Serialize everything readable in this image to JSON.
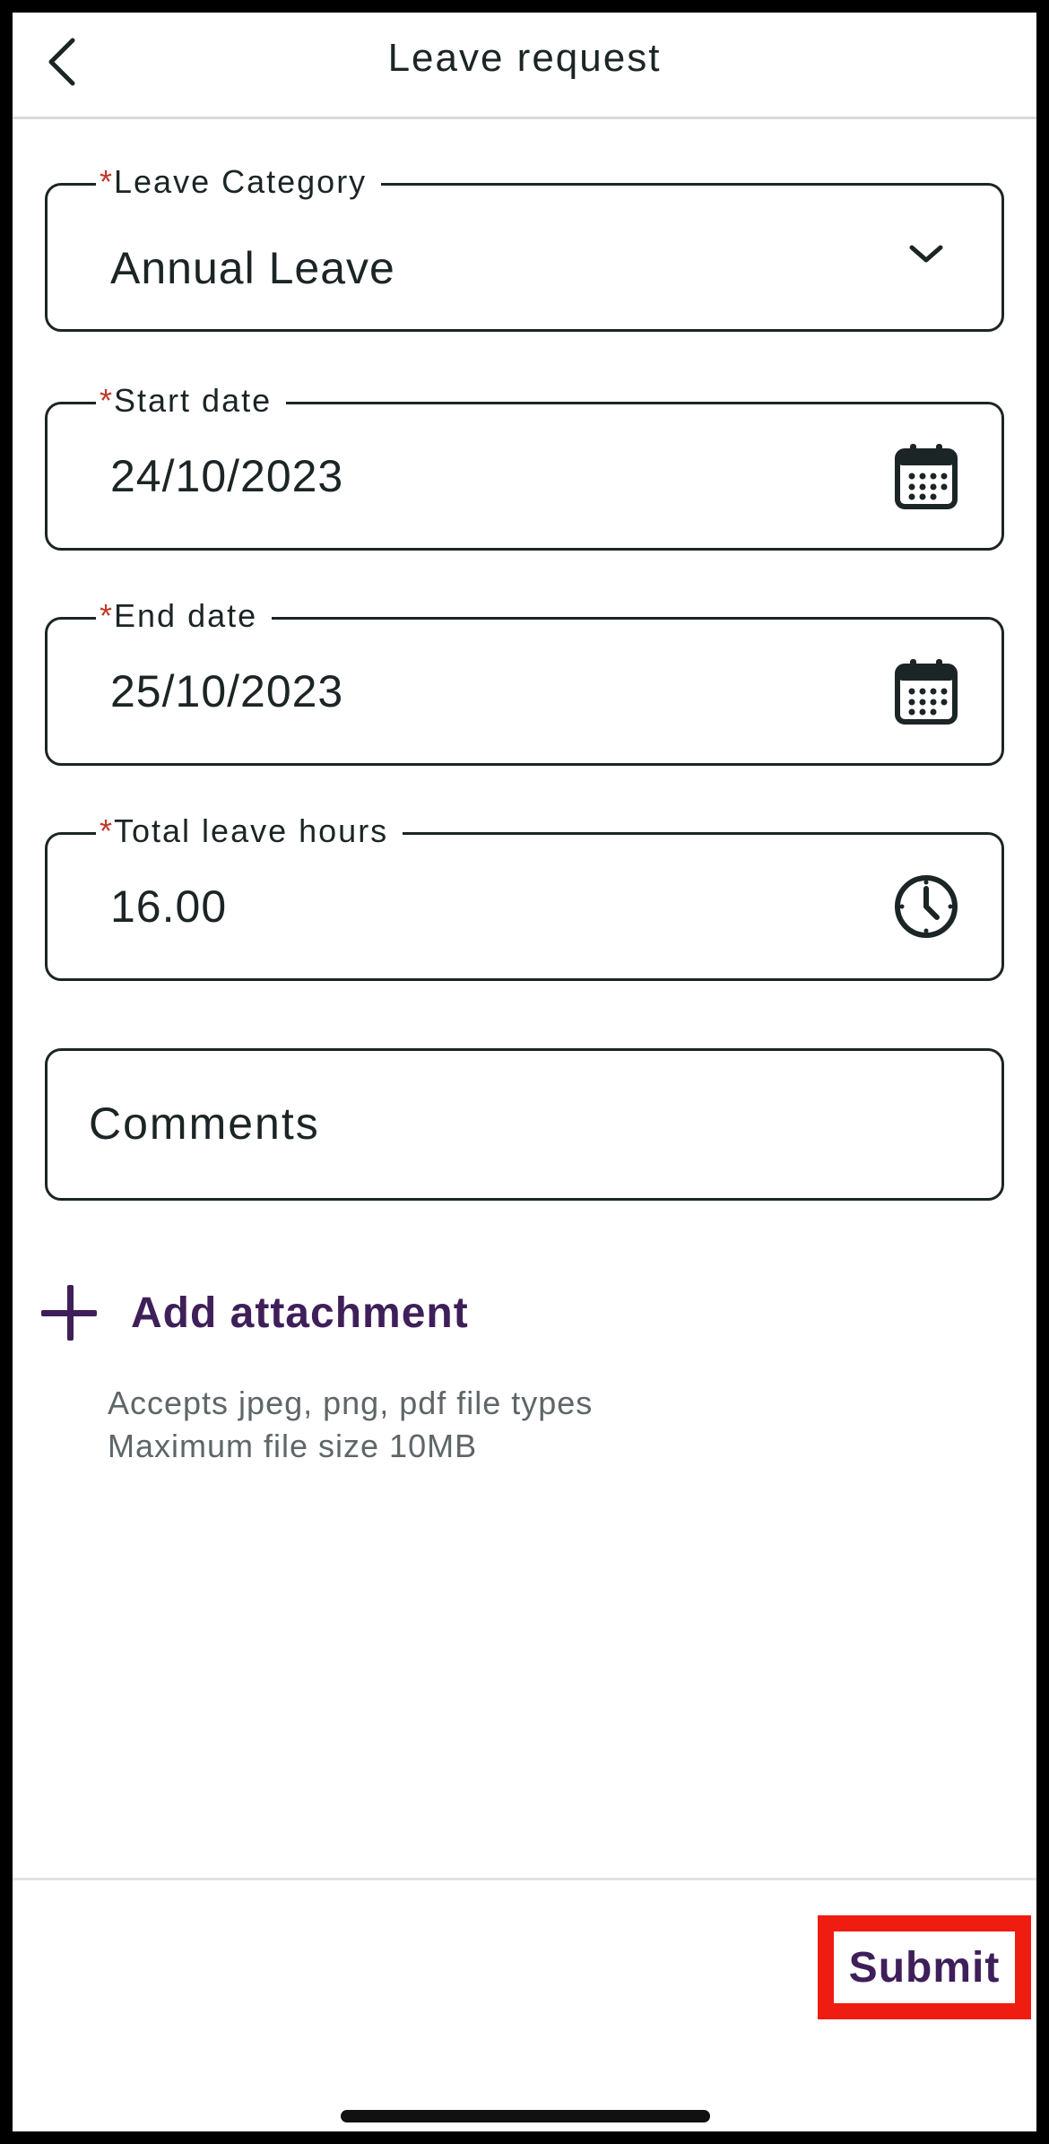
{
  "header": {
    "title": "Leave request",
    "back_icon": "chevron-left-icon"
  },
  "form": {
    "required_marker": "*",
    "leave_category": {
      "label": "Leave Category",
      "value": "Annual Leave",
      "icon": "chevron-down-icon"
    },
    "start_date": {
      "label": "Start date",
      "value": "24/10/2023",
      "icon": "calendar-icon"
    },
    "end_date": {
      "label": "End date",
      "value": "25/10/2023",
      "icon": "calendar-icon"
    },
    "total_hours": {
      "label": "Total leave hours",
      "value": "16.00",
      "icon": "clock-icon"
    },
    "comments": {
      "placeholder": "Comments"
    }
  },
  "attachment": {
    "label": "Add attachment",
    "icon": "plus-icon",
    "hint_types": "Accepts jpeg, png, pdf file types",
    "hint_size": "Maximum file size 10MB"
  },
  "footer": {
    "submit_label": "Submit"
  },
  "colors": {
    "accent": "#3f1f5a",
    "required": "#c0392b",
    "highlight": "#ee1c11",
    "text": "#1c2526",
    "muted": "#5e6668"
  }
}
